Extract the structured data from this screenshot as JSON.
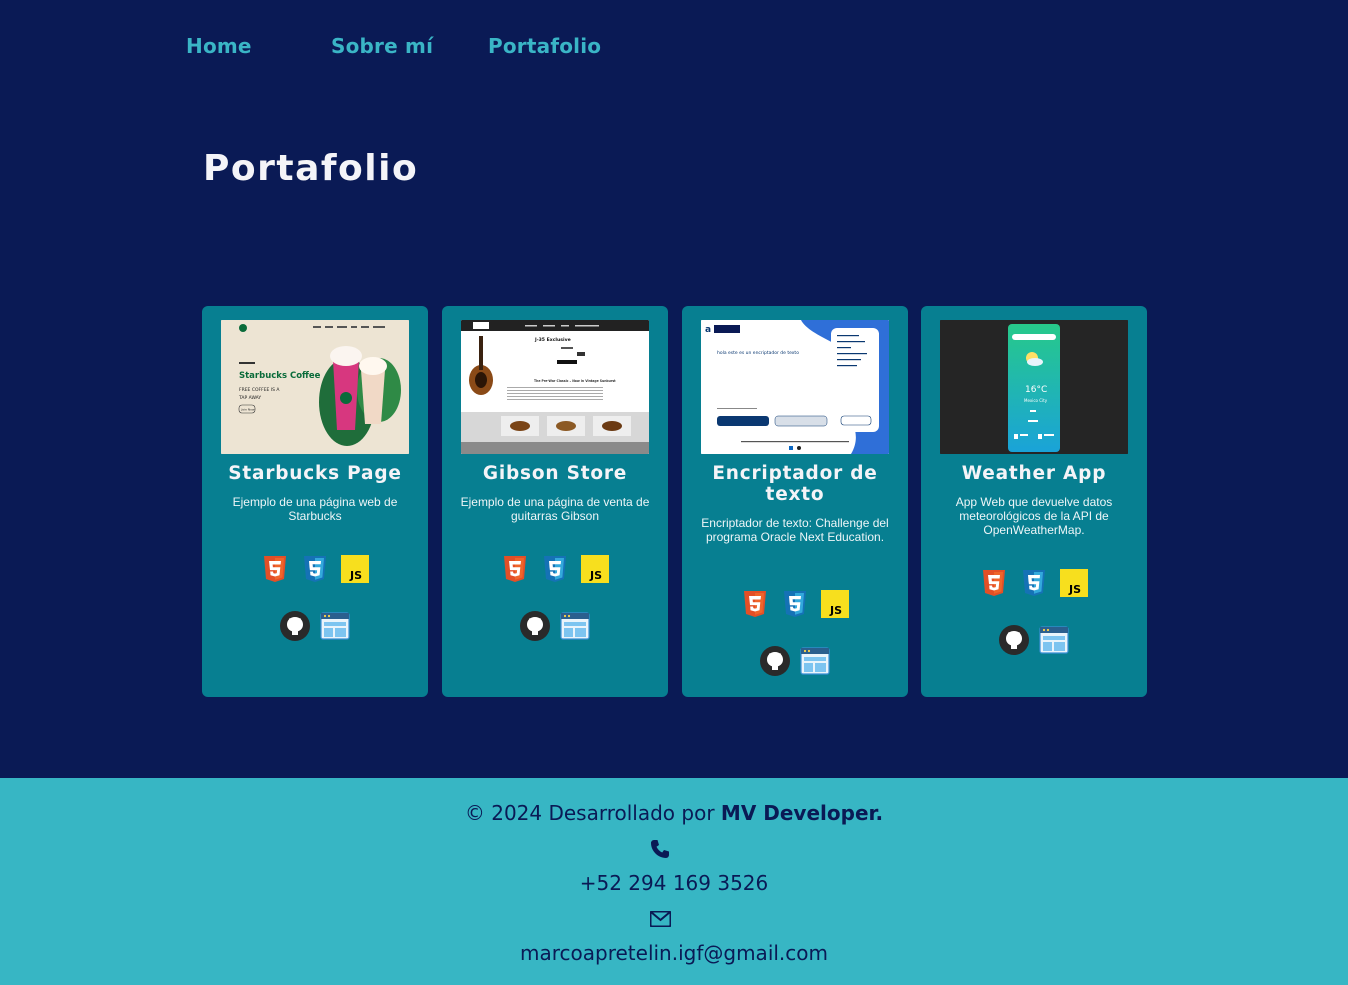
{
  "nav": {
    "items": [
      {
        "label": "Home"
      },
      {
        "label": "Sobre mí"
      },
      {
        "label": "Portafolio"
      }
    ]
  },
  "page": {
    "title": "Portafolio"
  },
  "projects": [
    {
      "title": "Starbucks Page",
      "description": "Ejemplo de una página web de Starbucks",
      "thumb": {
        "brand": "Starbucks Coffee",
        "line1": "FREE COFFEE IS A",
        "line2": "TAP AWAY",
        "button": "Join Now"
      },
      "tech": [
        "html5-icon",
        "css3-icon",
        "javascript-icon"
      ],
      "links": [
        "github-icon",
        "website-icon"
      ]
    },
    {
      "title": "Gibson Store",
      "description": "Ejemplo de una página de venta de guitarras Gibson",
      "thumb": {
        "heading": "J-35 Exclusive",
        "subheading": "The Pre-War Classic – Now in Vintage Sunburst"
      },
      "tech": [
        "html5-icon",
        "css3-icon",
        "javascript-icon"
      ],
      "links": [
        "github-icon",
        "website-icon"
      ]
    },
    {
      "title": "Encriptador de texto",
      "description": "Encriptador de texto: Challenge del programa Oracle Next Education.",
      "thumb": {
        "input_text": "hola este es un encriptador de texto"
      },
      "tech": [
        "html5-icon",
        "css3-icon",
        "javascript-icon"
      ],
      "links": [
        "github-icon",
        "website-icon"
      ]
    },
    {
      "title": "Weather App",
      "description": "App Web que devuelve datos meteorológicos de la API de OpenWeatherMap.",
      "thumb": {
        "temperature": "16°C",
        "city": "Mexico City"
      },
      "tech": [
        "html5-icon",
        "css3-icon",
        "javascript-icon"
      ],
      "links": [
        "github-icon",
        "website-icon"
      ]
    }
  ],
  "footer": {
    "credit_prefix": "© 2024 Desarrollado por",
    "credit_name": "MV Developer.",
    "phone": "+52 294 169 3526",
    "email": "marcoapretelin.igf@gmail.com"
  },
  "colors": {
    "background": "#0a1a55",
    "nav_link": "#3ab5c6",
    "card": "#077f91",
    "footer": "#37b6c4"
  }
}
